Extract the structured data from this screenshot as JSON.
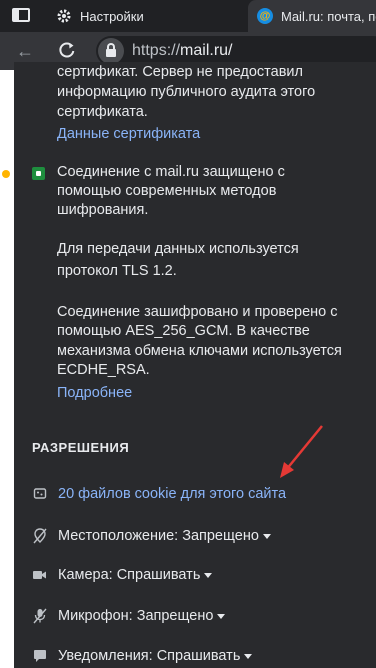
{
  "tabs": {
    "settings_title": "Настройки",
    "active_title": "Mail.ru: почта, поиск",
    "favicon_letter": "@"
  },
  "toolbar": {
    "url_scheme": "https://",
    "url_host": "mail.ru/"
  },
  "popup": {
    "cert_text_lines": [
      "сертификат. Сервер не предоставил",
      "информацию публичного аудита этого",
      "сертификата."
    ],
    "cert_link": "Данные сертификата",
    "secure_lines": [
      "Соединение с mail.ru защищено с",
      "помощью современных методов",
      "шифрования."
    ],
    "tls_lines": [
      "Для передачи данных используется",
      "протокол TLS 1.2."
    ],
    "cipher_lines": [
      "Соединение зашифровано и проверено с",
      "помощью AES_256_GCM. В качестве",
      "механизма обмена ключами используется",
      "ECDHE_RSA."
    ],
    "more_link": "Подробнее",
    "permissions_title": "РАЗРЕШЕНИЯ",
    "cookies_link": "20 файлов cookie для этого сайта",
    "permissions": [
      {
        "label": "Местоположение:",
        "value": "Запрещено"
      },
      {
        "label": "Камера:",
        "value": "Спрашивать"
      },
      {
        "label": "Микрофон:",
        "value": "Запрещено"
      },
      {
        "label": "Уведомления:",
        "value": "Спрашивать"
      }
    ]
  },
  "colors": {
    "link": "#8ab4f8",
    "annotation_arrow": "#e53935",
    "secure_green": "#1e8e3e"
  }
}
